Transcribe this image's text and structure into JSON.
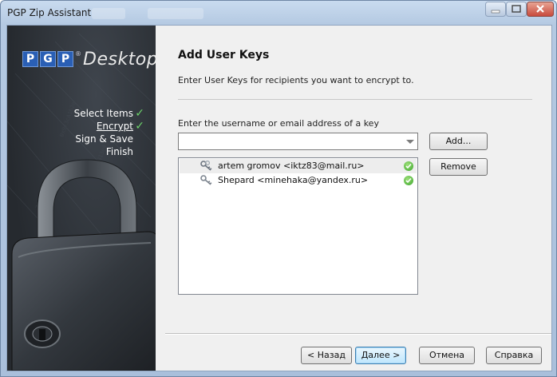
{
  "window": {
    "title": "PGP Zip Assistant"
  },
  "sidebar": {
    "logo_letters": [
      "P",
      "G",
      "P"
    ],
    "logo_reg": "®",
    "logo_word": "Desktop",
    "steps": [
      {
        "label": "Select Items",
        "done": true
      },
      {
        "label": "Encrypt",
        "done": true,
        "active": true
      },
      {
        "label": "Sign & Save",
        "done": false
      },
      {
        "label": "Finish",
        "done": false
      }
    ],
    "check_glyph": "✓"
  },
  "page": {
    "title": "Add User Keys",
    "description": "Enter User Keys for recipients you want to encrypt to.",
    "field_label": "Enter the username or email address of a key",
    "input_value": ""
  },
  "buttons": {
    "add": "Add...",
    "remove": "Remove",
    "back": "< Назад",
    "next": "Далее >",
    "cancel": "Отмена",
    "help": "Справка"
  },
  "keys": [
    {
      "name": "artem gromov <iktz83@mail.ru>",
      "icon": "key-pair-icon",
      "status": "valid",
      "selected": true
    },
    {
      "name": "Shepard <minehaka@yandex.ru>",
      "icon": "public-key-icon",
      "status": "valid",
      "selected": false
    }
  ],
  "colors": {
    "accent_blue": "#2a5fb5",
    "check_green": "#6cd16a",
    "valid_green": "#3aa52a"
  }
}
